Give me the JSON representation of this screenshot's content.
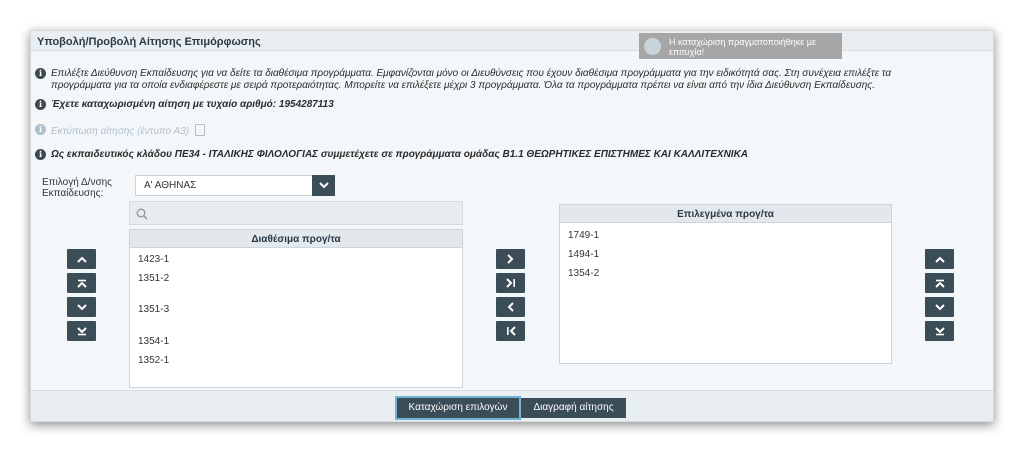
{
  "panel": {
    "title": "Υποβολή/Προβολή Αίτησης Επιμόρφωσης"
  },
  "toast": {
    "message": "Η καταχώριση πραγματοποιήθηκε με επιτυχία!"
  },
  "info": {
    "instructions_line1": "Επιλέξτε Διεύθυνση Εκπαίδευσης για να δείτε τα διαθέσιμα προγράμματα. Εμφανίζονται μόνο οι Διευθύνσεις που έχουν διαθέσιμα προγράμματα για την ειδικότητά σας. Στη συνέχεια επιλέξτε τα",
    "instructions_line2": "προγράμματα για τα οποία ενδιαφέρεστε με σειρά προτεραιότητας. Μπορείτε να επιλέξετε μέχρι 3 προγράμματα. Όλα τα προγράμματα πρέπει να είναι από την ίδια Διεύθυνση Εκπαίδευσης.",
    "registered": "Έχετε καταχωρισμένη αίτηση με τυχαίο αριθμό: 1954287113",
    "print_link": "Εκτύπωση αίτησης (έντυπο Α3)",
    "branch_notice": "Ως εκπαιδευτικός κλάδου ΠΕ34 - ΙΤΑΛΙΚΗΣ ΦΙΛΟΛΟΓΙΑΣ συμμετέχετε σε προγράμματα ομάδας Β1.1 ΘΕΩΡΗΤΙΚΕΣ ΕΠΙΣΤΗΜΕΣ ΚΑΙ ΚΑΛΛΙΤΕΧΝΙΚΑ"
  },
  "directorate": {
    "label": "Επιλογή Δ/νσης Εκπαίδευσης:",
    "selected": "Α' ΑΘΗΝΑΣ"
  },
  "search": {
    "placeholder": ""
  },
  "available": {
    "header": "Διαθέσιμα προγ/τα",
    "items": [
      "1423-1",
      "1351-2",
      "1351-3",
      "1354-1",
      "1352-1"
    ]
  },
  "selected": {
    "header": "Επιλεγμένα προγ/τα",
    "items": [
      "1749-1",
      "1494-1",
      "1354-2"
    ]
  },
  "footer": {
    "save_label": "Καταχώριση επιλογών",
    "delete_label": "Διαγραφή αίτησης"
  },
  "icons": {
    "info": "info-circle-icon",
    "pdf": "pdf-file-icon",
    "dropdown": "chevron-down-icon",
    "search": "search-icon",
    "move_up": "chevron-up-icon",
    "move_top": "chevron-top-icon",
    "move_down": "chevron-down-icon",
    "move_bottom": "chevron-bottom-icon",
    "move_right": "chevron-right-icon",
    "move_all_right": "chevron-right-end-icon",
    "move_left": "chevron-left-icon",
    "move_all_left": "chevron-left-end-icon"
  },
  "colors": {
    "button": "#3b4d57",
    "header_bg": "#e8eef2",
    "toast_bg": "#a6a6a6",
    "muted_text": "#aebfcc"
  }
}
